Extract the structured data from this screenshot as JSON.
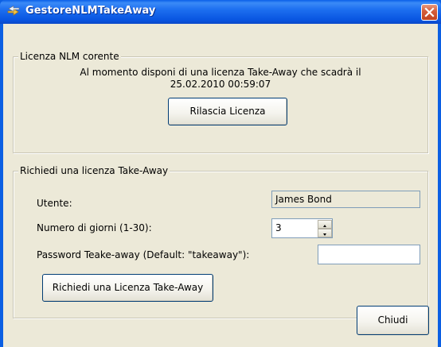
{
  "window": {
    "title": "GestoreNLMTakeAway",
    "colors": {
      "titlebar": "#0b5fe3",
      "close": "#d65f3c",
      "client": "#ece9d8"
    }
  },
  "license_group": {
    "legend": "Licenza NLM corente",
    "message_line1": "Al momento disponi di una licenza Take-Away che scadrà il",
    "message_line2": "25.02.2010 00:59:07",
    "release_button": "Rilascia Licenza"
  },
  "request_group": {
    "legend": "Richiedi una licenza Take-Away",
    "user_label": "Utente:",
    "user_value": "James Bond",
    "days_label": "Numero di giorni (1-30):",
    "days_value": "3",
    "password_label": "Password Teake-away (Default: \"takeaway\"):",
    "password_value": "",
    "request_button": "Richiedi una Licenza Take-Away"
  },
  "footer": {
    "close_button": "Chiudi"
  },
  "icons": {
    "app": "arrows-icon",
    "close": "close-icon",
    "spin_up": "arrow-up-icon",
    "spin_down": "arrow-down-icon"
  }
}
